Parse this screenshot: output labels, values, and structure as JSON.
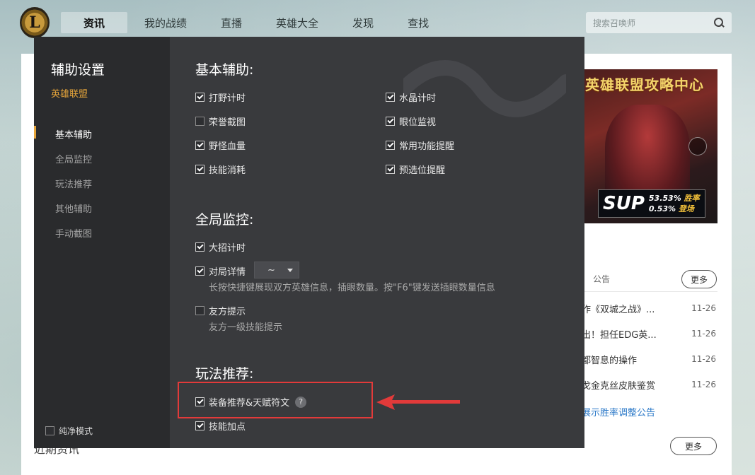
{
  "topnav": {
    "logo": "L",
    "items": [
      "资讯",
      "我的战绩",
      "直播",
      "英雄大全",
      "发现",
      "查找"
    ],
    "active_index": 0,
    "search_placeholder": "搜索召唤师"
  },
  "background_page": {
    "banner_title": "英雄联盟攻略中心",
    "banner_role": "SUP",
    "banner_win_rate": "53.53%",
    "banner_win_label": "胜率",
    "banner_pick_rate": "0.53%",
    "banner_pick_label": "登场",
    "announce_tab": "公告",
    "more": "更多",
    "announcements": [
      {
        "title": "作《双城之战》...",
        "date": "11-26"
      },
      {
        "title": "出！担任EDG英...",
        "date": "11-26"
      },
      {
        "title": "都智息的操作",
        "date": "11-26"
      },
      {
        "title": "戈金克丝皮肤鉴赏",
        "date": "11-26"
      }
    ],
    "link": "展示胜率调整公告",
    "bottom_heading": "近期资讯",
    "more2": "更多"
  },
  "dialog": {
    "title": "辅助设置",
    "game": "英雄联盟",
    "menu": [
      "基本辅助",
      "全局监控",
      "玩法推荐",
      "其他辅助",
      "手动截图"
    ],
    "active_menu": 0,
    "pure_mode": "纯净模式",
    "close": "×",
    "sections": {
      "basic": {
        "title": "基本辅助:",
        "options": [
          {
            "label": "打野计时",
            "checked": true
          },
          {
            "label": "水晶计时",
            "checked": true
          },
          {
            "label": "荣誉截图",
            "checked": false
          },
          {
            "label": "眼位监视",
            "checked": true
          },
          {
            "label": "野怪血量",
            "checked": true
          },
          {
            "label": "常用功能提醒",
            "checked": true
          },
          {
            "label": "技能消耗",
            "checked": true
          },
          {
            "label": "预选位提醒",
            "checked": true
          }
        ]
      },
      "global": {
        "title": "全局监控:",
        "ult_timer": "大招计时",
        "match_detail": "对局详情",
        "hotkey_value": "~",
        "match_detail_desc": "长按快捷键展现双方英雄信息，插眼数量。按\"F6\"键发送插眼数量信息",
        "ally_tip": "友方提示",
        "ally_tip_desc": "友方一级技能提示"
      },
      "play": {
        "title": "玩法推荐:",
        "equip_rune": "装备推荐&天赋符文",
        "help": "?",
        "skill_points": "技能加点"
      }
    }
  },
  "colors": {
    "dialog_bg": "#393a3d",
    "sidebar_bg": "#2a2b2d",
    "accent": "#e6a53a",
    "highlight": "#e23a3a"
  }
}
